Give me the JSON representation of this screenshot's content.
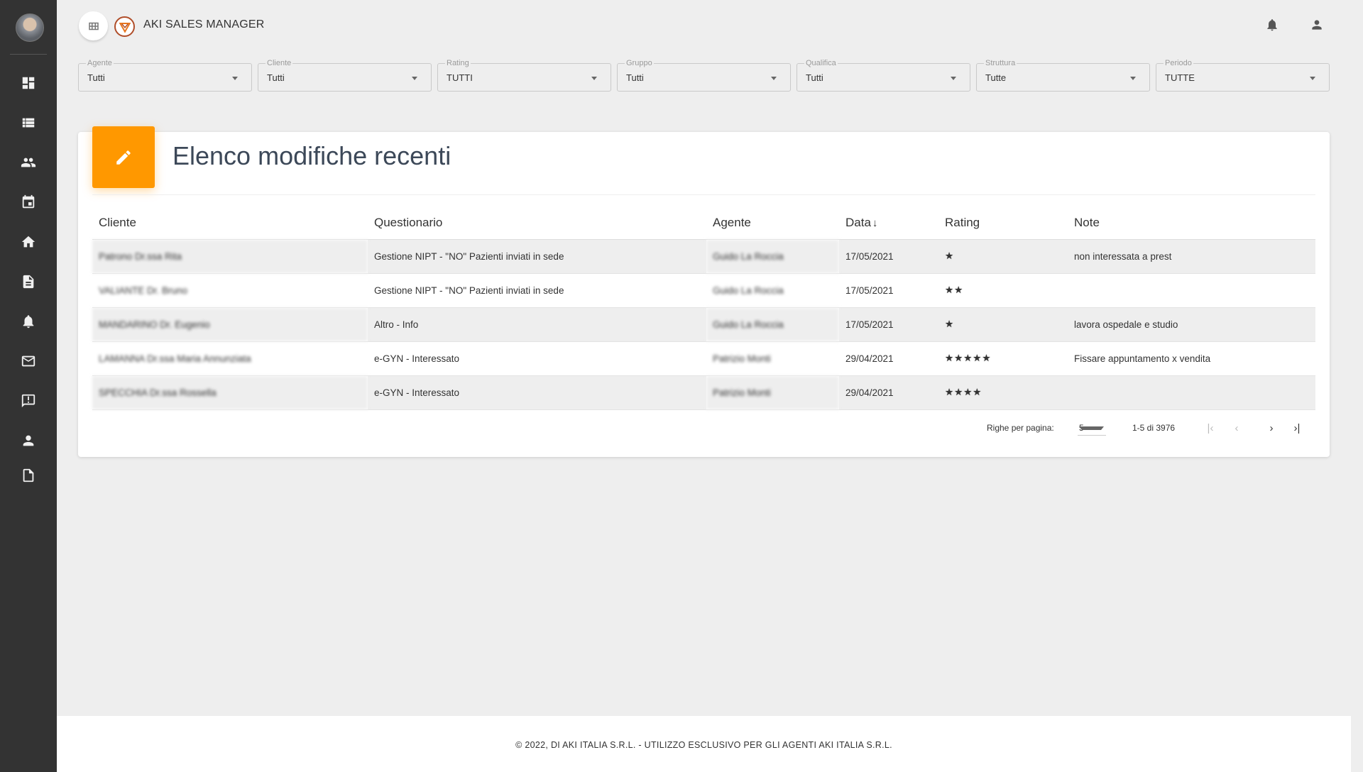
{
  "app": {
    "title": "AKI SALES MANAGER"
  },
  "sidebar": {
    "items": [
      {
        "icon": "dashboard-icon"
      },
      {
        "icon": "list-icon"
      },
      {
        "icon": "people-icon"
      },
      {
        "icon": "calendar-icon"
      },
      {
        "icon": "home-icon"
      },
      {
        "icon": "document-icon"
      },
      {
        "icon": "bell-icon"
      },
      {
        "icon": "mail-icon"
      },
      {
        "icon": "feedback-icon"
      },
      {
        "icon": "person-icon"
      },
      {
        "icon": "file-icon"
      }
    ]
  },
  "filters": [
    {
      "label": "Agente",
      "value": "Tutti"
    },
    {
      "label": "Cliente",
      "value": "Tutti"
    },
    {
      "label": "Rating",
      "value": "TUTTI"
    },
    {
      "label": "Gruppo",
      "value": "Tutti"
    },
    {
      "label": "Qualifica",
      "value": "Tutti"
    },
    {
      "label": "Struttura",
      "value": "Tutte"
    },
    {
      "label": "Periodo",
      "value": "TUTTE"
    }
  ],
  "card": {
    "title": "Elenco modifiche recenti",
    "columns": {
      "cliente": "Cliente",
      "questionario": "Questionario",
      "agente": "Agente",
      "data": "Data",
      "rating": "Rating",
      "note": "Note"
    },
    "rows": [
      {
        "cliente": "Patrono Dr.ssa Rita",
        "questionario": "Gestione NIPT - \"NO\" Pazienti inviati in sede",
        "agente": "Guido La Roccia",
        "data": "17/05/2021",
        "rating": "★",
        "note": "non interessata a prest"
      },
      {
        "cliente": "VALIANTE Dr. Bruno",
        "questionario": "Gestione NIPT - \"NO\" Pazienti inviati in sede",
        "agente": "Guido La Roccia",
        "data": "17/05/2021",
        "rating": "★★",
        "note": ""
      },
      {
        "cliente": "MANDARINO Dr. Eugenio",
        "questionario": "Altro - Info",
        "agente": "Guido La Roccia",
        "data": "17/05/2021",
        "rating": "★",
        "note": "lavora ospedale e studio"
      },
      {
        "cliente": "LAMANNA Dr.ssa Maria Annunziata",
        "questionario": "e-GYN - Interessato",
        "agente": "Patrizio Monti",
        "data": "29/04/2021",
        "rating": "★★★★★",
        "note": "Fissare appuntamento x vendita"
      },
      {
        "cliente": "SPECCHIA Dr.ssa Rossella",
        "questionario": "e-GYN - Interessato",
        "agente": "Patrizio Monti",
        "data": "29/04/2021",
        "rating": "★★★★",
        "note": ""
      }
    ],
    "pagination": {
      "rows_per_page_label": "Righe per pagina:",
      "rows_per_page": "5",
      "range": "1-5 di 3976"
    }
  },
  "footer": {
    "text": "© 2022, DI AKI ITALIA S.R.L. - UTILIZZO ESCLUSIVO PER GLI AGENTI AKI ITALIA S.R.L."
  },
  "colors": {
    "sidebar": "#333333",
    "accent": "#ff9800",
    "background": "#eeeeee",
    "star": "#f5c518"
  }
}
